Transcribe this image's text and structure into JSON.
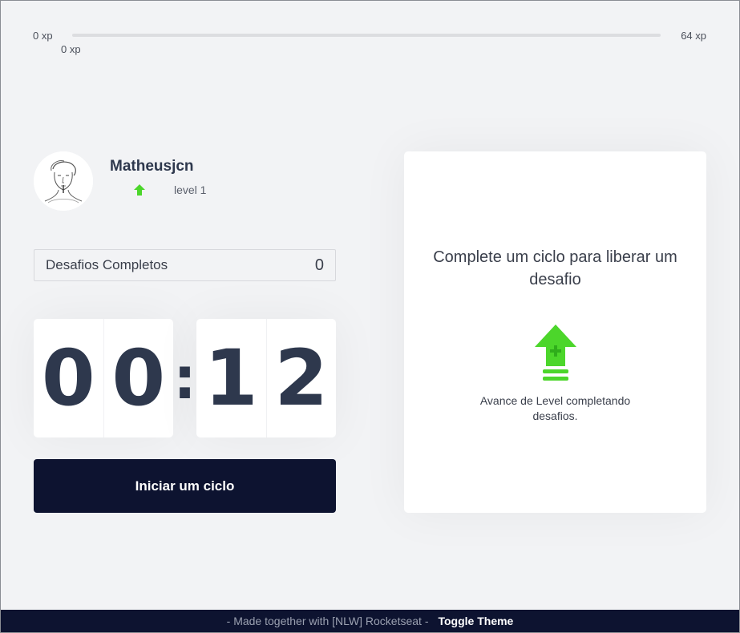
{
  "xp": {
    "min_label": "0 xp",
    "max_label": "64 xp",
    "current_label": "0 xp",
    "progress": 0,
    "fill_color": "#4cd62b"
  },
  "profile": {
    "name": "Matheusjcn",
    "level_label": "level 1",
    "level_icon": "level-up-arrow-icon"
  },
  "completed_challenges": {
    "label": "Desafios Completos",
    "value": "0"
  },
  "countdown": {
    "minute_left": "0",
    "minute_right": "0",
    "separator": ":",
    "second_left": "1",
    "second_right": "2"
  },
  "start_button": {
    "label": "Iniciar um ciclo"
  },
  "challenge_box": {
    "title": "Complete um ciclo para liberar um desafio",
    "icon": "level-up-icon",
    "description": "Avance de Level completando desafios."
  },
  "footer": {
    "text": "- Made together with [NLW] Rocketseat -",
    "toggle_label": "Toggle Theme"
  },
  "colors": {
    "background": "#f2f3f5",
    "primary_dark": "#0d1330",
    "accent_green": "#4cd62b",
    "text": "#2e384d"
  }
}
